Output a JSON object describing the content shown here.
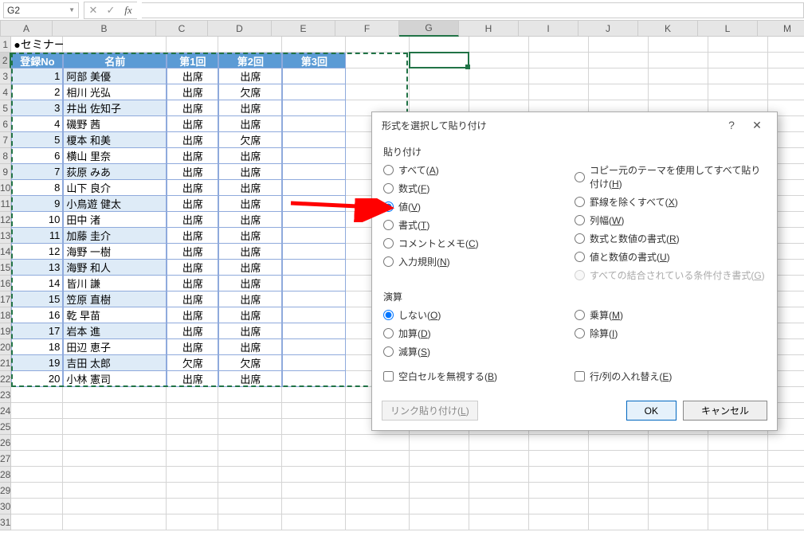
{
  "formulaBar": {
    "cellRef": "G2",
    "fx": "fx"
  },
  "columns": [
    "A",
    "B",
    "C",
    "D",
    "E",
    "F",
    "G",
    "H",
    "I",
    "J",
    "K",
    "L",
    "M"
  ],
  "title": "●セミナー受講者名簿",
  "headers": {
    "no": "登録No",
    "name": "名前",
    "s1": "第1回",
    "s2": "第2回",
    "s3": "第3回"
  },
  "rows": [
    {
      "no": "1",
      "name": "阿部   美優",
      "s1": "出席",
      "s2": "出席",
      "s3": ""
    },
    {
      "no": "2",
      "name": "相川   光弘",
      "s1": "出席",
      "s2": "欠席",
      "s3": ""
    },
    {
      "no": "3",
      "name": "井出   佐知子",
      "s1": "出席",
      "s2": "出席",
      "s3": ""
    },
    {
      "no": "4",
      "name": "磯野   茜",
      "s1": "出席",
      "s2": "出席",
      "s3": ""
    },
    {
      "no": "5",
      "name": "榎本   和美",
      "s1": "出席",
      "s2": "欠席",
      "s3": ""
    },
    {
      "no": "6",
      "name": "横山   里奈",
      "s1": "出席",
      "s2": "出席",
      "s3": ""
    },
    {
      "no": "7",
      "name": "荻原   みあ",
      "s1": "出席",
      "s2": "出席",
      "s3": ""
    },
    {
      "no": "8",
      "name": "山下   良介",
      "s1": "出席",
      "s2": "出席",
      "s3": ""
    },
    {
      "no": "9",
      "name": "小鳥遊   健太",
      "s1": "出席",
      "s2": "出席",
      "s3": ""
    },
    {
      "no": "10",
      "name": "田中   渚",
      "s1": "出席",
      "s2": "出席",
      "s3": ""
    },
    {
      "no": "11",
      "name": "加藤   圭介",
      "s1": "出席",
      "s2": "出席",
      "s3": ""
    },
    {
      "no": "12",
      "name": "海野   一樹",
      "s1": "出席",
      "s2": "出席",
      "s3": ""
    },
    {
      "no": "13",
      "name": "海野   和人",
      "s1": "出席",
      "s2": "出席",
      "s3": ""
    },
    {
      "no": "14",
      "name": "皆川   謙",
      "s1": "出席",
      "s2": "出席",
      "s3": ""
    },
    {
      "no": "15",
      "name": "笠原   直樹",
      "s1": "出席",
      "s2": "出席",
      "s3": ""
    },
    {
      "no": "16",
      "name": "乾   早苗",
      "s1": "出席",
      "s2": "出席",
      "s3": ""
    },
    {
      "no": "17",
      "name": "岩本   進",
      "s1": "出席",
      "s2": "出席",
      "s3": ""
    },
    {
      "no": "18",
      "name": "田辺   恵子",
      "s1": "出席",
      "s2": "出席",
      "s3": ""
    },
    {
      "no": "19",
      "name": "吉田   太郎",
      "s1": "欠席",
      "s2": "欠席",
      "s3": ""
    },
    {
      "no": "20",
      "name": "小林   憲司",
      "s1": "出席",
      "s2": "出席",
      "s3": ""
    }
  ],
  "dialog": {
    "title": "形式を選択して貼り付け",
    "paste_label": "貼り付け",
    "operation_label": "演算",
    "pasteLeft": [
      {
        "key": "all",
        "label": "すべて",
        "accel": "A"
      },
      {
        "key": "formulas",
        "label": "数式",
        "accel": "F"
      },
      {
        "key": "values",
        "label": "値",
        "accel": "V"
      },
      {
        "key": "formats",
        "label": "書式",
        "accel": "T"
      },
      {
        "key": "comments",
        "label": "コメントとメモ",
        "accel": "C"
      },
      {
        "key": "validation",
        "label": "入力規則",
        "accel": "N"
      }
    ],
    "pasteRight": [
      {
        "key": "theme",
        "label": "コピー元のテーマを使用してすべて貼り付け",
        "accel": "H"
      },
      {
        "key": "noborder",
        "label": "罫線を除くすべて",
        "accel": "X"
      },
      {
        "key": "colwidth",
        "label": "列幅",
        "accel": "W"
      },
      {
        "key": "formnum",
        "label": "数式と数値の書式",
        "accel": "R"
      },
      {
        "key": "valnum",
        "label": "値と数値の書式",
        "accel": "U"
      },
      {
        "key": "cond",
        "label": "すべての結合されている条件付き書式",
        "accel": "G",
        "disabled": true
      }
    ],
    "opLeft": [
      {
        "key": "none",
        "label": "しない",
        "accel": "O"
      },
      {
        "key": "add",
        "label": "加算",
        "accel": "D"
      },
      {
        "key": "sub",
        "label": "減算",
        "accel": "S"
      }
    ],
    "opRight": [
      {
        "key": "mul",
        "label": "乗算",
        "accel": "M"
      },
      {
        "key": "div",
        "label": "除算",
        "accel": "I"
      }
    ],
    "skipBlanks": "空白セルを無視する",
    "skipBlanksAccel": "B",
    "transpose": "行/列の入れ替え",
    "transposeAccel": "E",
    "linkPaste": "リンク貼り付け",
    "linkPasteAccel": "L",
    "ok": "OK",
    "cancel": "キャンセル",
    "selectedPaste": "values",
    "selectedOp": "none"
  }
}
